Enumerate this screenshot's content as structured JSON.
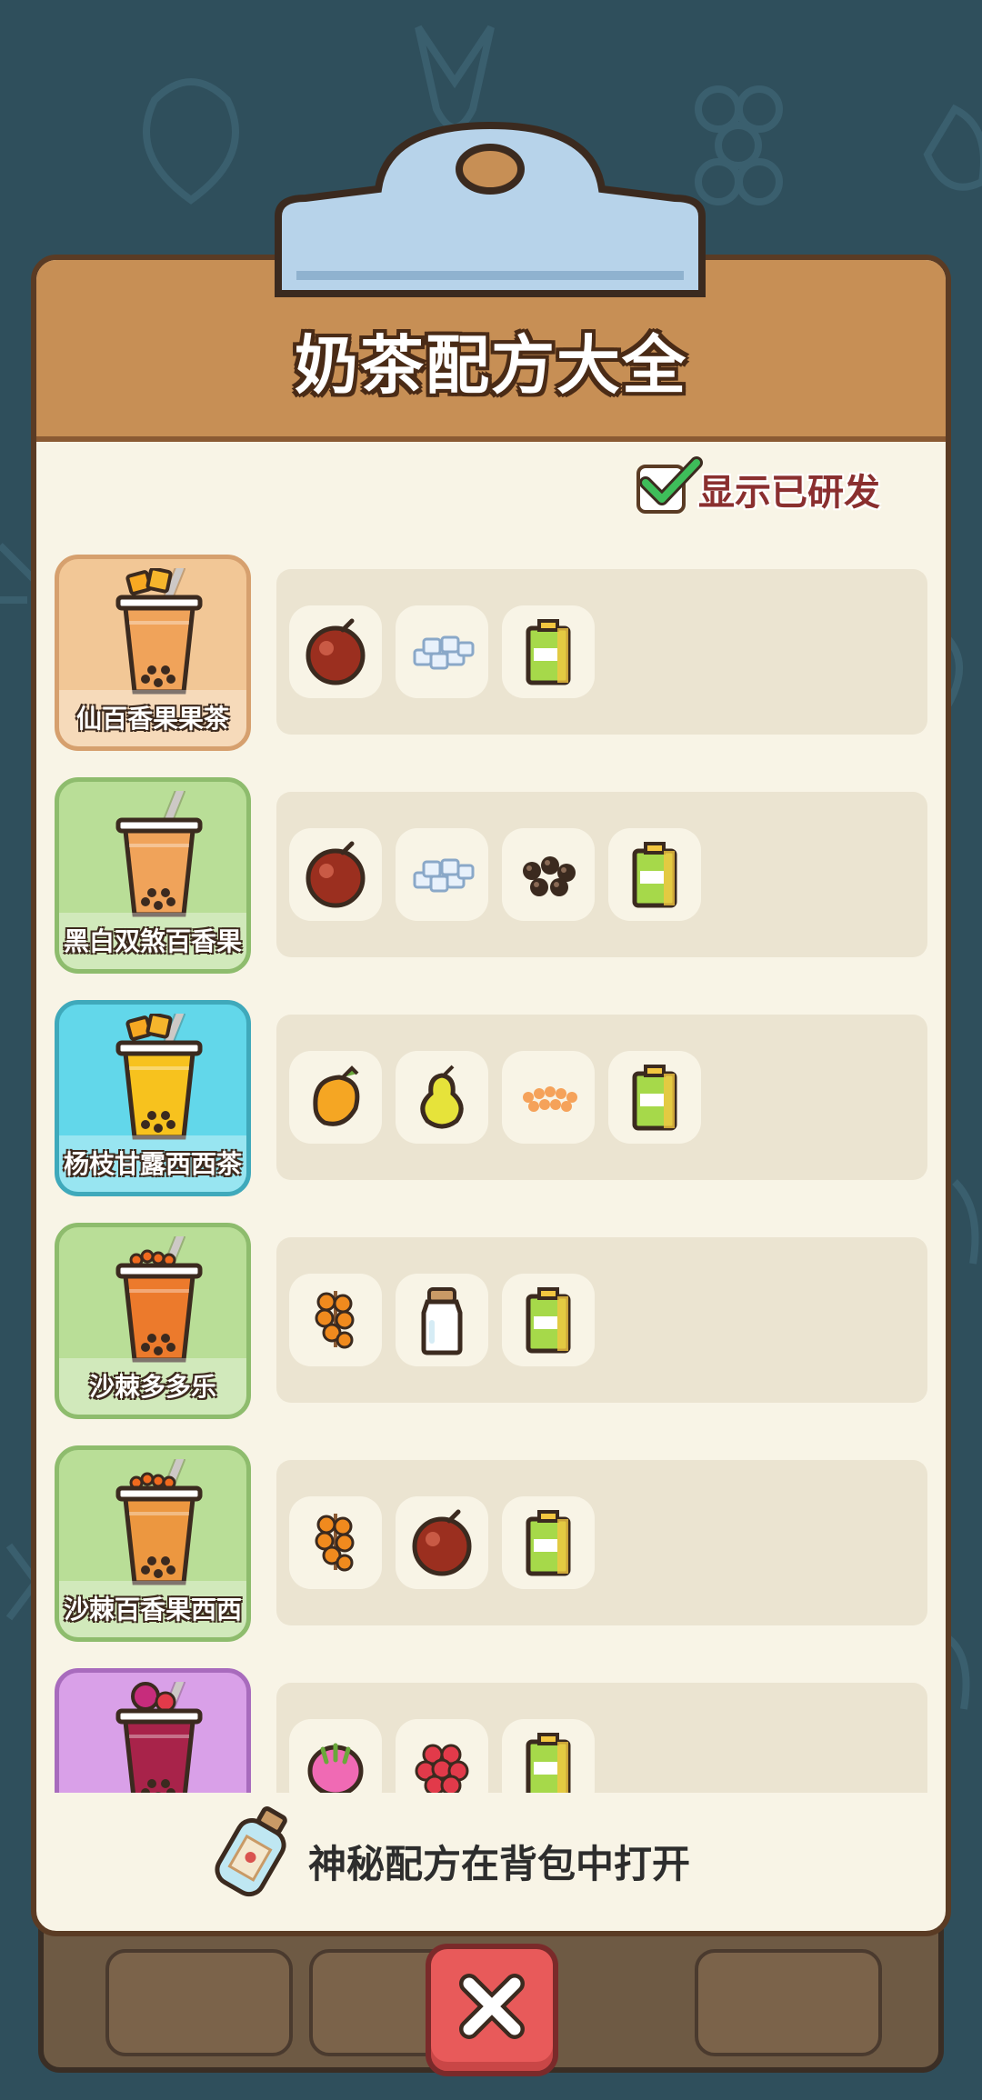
{
  "title": "奶茶配方大全",
  "toggle": {
    "label": "显示已研发",
    "checked": true
  },
  "recipes": [
    {
      "name": "仙百香果果茶",
      "theme": "#f2c796",
      "border": "#d6a06e",
      "drink_color": "#f0a35a",
      "topping": "fruit-chunks-icon",
      "ingredients": [
        "passion-fruit-icon",
        "sugar-cubes-icon",
        "juice-box-icon"
      ]
    },
    {
      "name": "黑白双煞百香果",
      "theme": "#b9de97",
      "border": "#8ebc6d",
      "drink_color": "#f0a35a",
      "topping": "none",
      "ingredients": [
        "passion-fruit-icon",
        "sugar-cubes-icon",
        "tapioca-pearls-icon",
        "juice-box-icon"
      ]
    },
    {
      "name": "杨枝甘露西西茶",
      "theme": "#62d7ea",
      "border": "#3fa9bb",
      "drink_color": "#f7c21e",
      "topping": "mango-chunks-icon",
      "ingredients": [
        "mango-icon",
        "pear-icon",
        "sago-icon",
        "juice-box-icon"
      ]
    },
    {
      "name": "沙棘多多乐",
      "theme": "#b9de97",
      "border": "#8ebc6d",
      "drink_color": "#ec7a2c",
      "topping": "sea-buckthorn-icon",
      "ingredients": [
        "sea-buckthorn-icon",
        "milk-bottle-icon",
        "juice-box-icon"
      ]
    },
    {
      "name": "沙棘百香果西西",
      "theme": "#b9de97",
      "border": "#8ebc6d",
      "drink_color": "#ec9740",
      "topping": "sea-buckthorn-icon",
      "ingredients": [
        "sea-buckthorn-icon",
        "passion-fruit-icon",
        "juice-box-icon"
      ]
    },
    {
      "name": "",
      "theme": "#d9a0e8",
      "border": "#a86bbd",
      "drink_color": "#a8234a",
      "topping": "dragon-fruit-icon",
      "ingredients": [
        "dragon-fruit-icon",
        "raspberry-icon",
        "juice-box-icon"
      ]
    }
  ],
  "footer": {
    "text": "神秘配方在背包中打开",
    "icon": "message-bottle-icon"
  },
  "close_button": {
    "icon": "close-icon"
  }
}
